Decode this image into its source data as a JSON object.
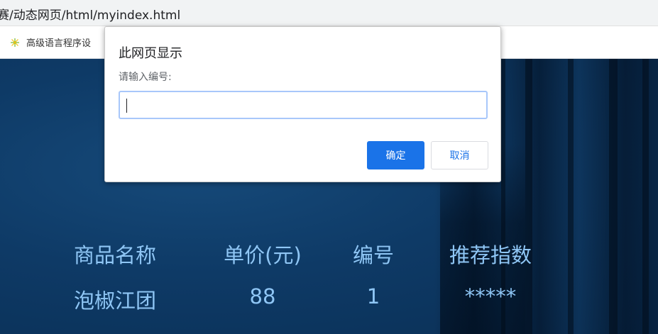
{
  "browser": {
    "url": "赛/动态网页/html/myindex.html",
    "bookmark_label": "高级语言程序设"
  },
  "table": {
    "headers": [
      "商品名称",
      "单价(元)",
      "编号",
      "推荐指数"
    ],
    "rows": [
      [
        "泡椒江团",
        "88",
        "1",
        "*****"
      ]
    ]
  },
  "dialog": {
    "title": "此网页显示",
    "message": "请输入编号:",
    "input_value": "",
    "ok_label": "确定",
    "cancel_label": "取消"
  },
  "colors": {
    "accent": "#1a73e8",
    "page_bg": "#0e3a66",
    "table_text": "#8fc6f5"
  }
}
